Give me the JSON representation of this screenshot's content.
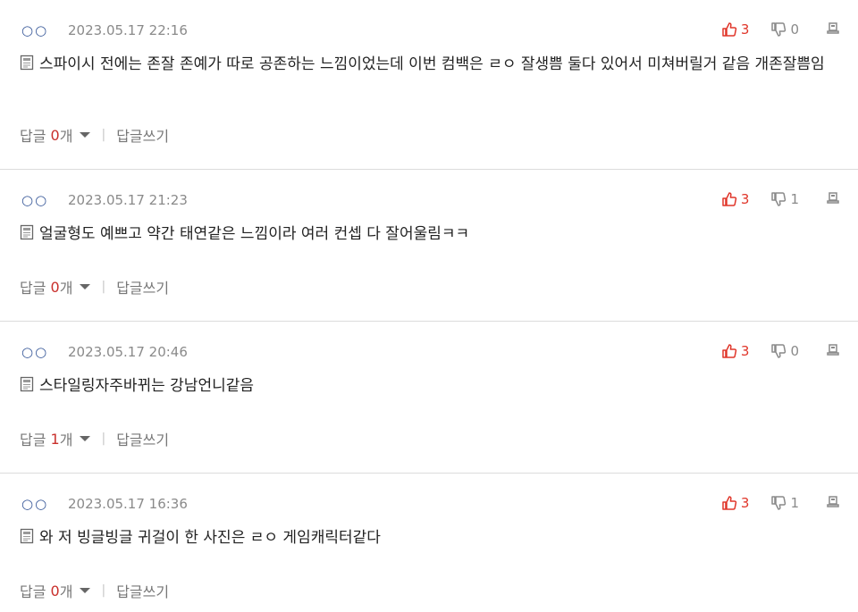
{
  "comments": [
    {
      "author": "○○",
      "date": "2023.05.17 22:16",
      "likes": "3",
      "dislikes": "0",
      "text": "스파이시 전에는 존잘 존예가 따로 공존하는 느낌이었는데 이번 컴백은 ㄹㅇ 잘생쁨 둘다 있어서 미쳐버릴거 같음 개존잘쁨임",
      "reply_label": "답글",
      "reply_count": "0",
      "reply_unit": "개",
      "write_reply": "답글쓰기"
    },
    {
      "author": "○○",
      "date": "2023.05.17 21:23",
      "likes": "3",
      "dislikes": "1",
      "text": "얼굴형도 예쁘고 약간 태연같은 느낌이라 여러 컨셉 다 잘어울림ㅋㅋ",
      "reply_label": "답글",
      "reply_count": "0",
      "reply_unit": "개",
      "write_reply": "답글쓰기"
    },
    {
      "author": "○○",
      "date": "2023.05.17 20:46",
      "likes": "3",
      "dislikes": "0",
      "text": "스타일링자주바뀌는 강남언니같음",
      "reply_label": "답글",
      "reply_count": "1",
      "reply_unit": "개",
      "write_reply": "답글쓰기"
    },
    {
      "author": "○○",
      "date": "2023.05.17 16:36",
      "likes": "3",
      "dislikes": "1",
      "text": "와 저 빙글빙글 귀걸이 한 사진은 ㄹㅇ 게임캐릭터같다",
      "reply_label": "답글",
      "reply_count": "0",
      "reply_unit": "개",
      "write_reply": "답글쓰기"
    }
  ],
  "separator": "|",
  "colors": {
    "like": "#e0362a",
    "reply_count": "#c9302c",
    "author": "#3a5a9a",
    "muted": "#8a8a8a"
  },
  "icons": {
    "like": "thumbs-up-icon",
    "dislike": "thumbs-down-icon",
    "report": "report-icon",
    "doc": "document-icon",
    "caret": "caret-down-icon"
  }
}
